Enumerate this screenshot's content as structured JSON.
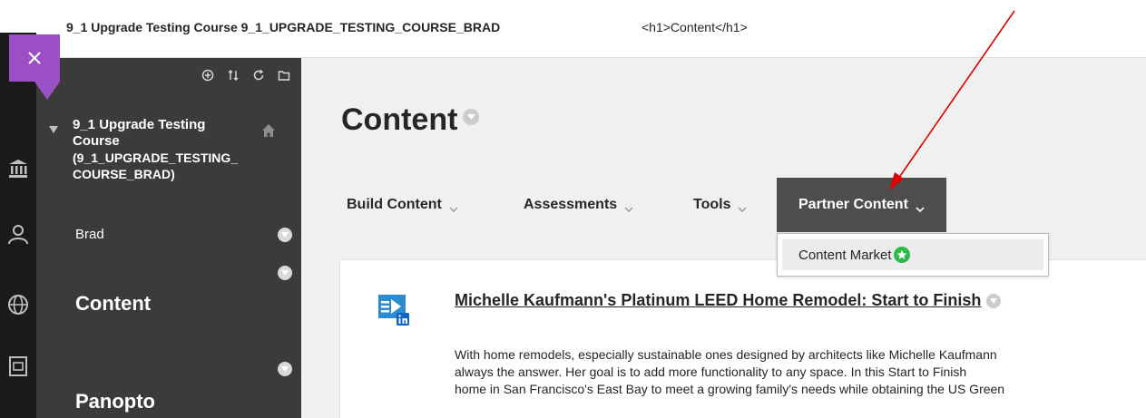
{
  "topbar": {
    "course_path": "9_1 Upgrade Testing Course 9_1_UPGRADE_TESTING_COURSE_BRAD",
    "page_crumb": "<h1>Content</h1>"
  },
  "course_menu": {
    "course_name_line1": "9_1 Upgrade Testing",
    "course_name_line2": "Course",
    "course_code_line1": "(9_1_UPGRADE_TESTING_",
    "course_code_line2": "COURSE_BRAD)",
    "items": [
      {
        "label": "Brad"
      },
      {
        "label": "Content"
      },
      {
        "label": "Panopto"
      }
    ]
  },
  "main": {
    "page_title": "Content",
    "actions": [
      {
        "label": "Build Content"
      },
      {
        "label": "Assessments"
      },
      {
        "label": "Tools"
      },
      {
        "label": "Partner Content"
      }
    ],
    "dropdown": {
      "item_label": "Content Market"
    },
    "content_item": {
      "title": "Michelle Kaufmann's Platinum LEED Home Remodel: Start to Finish",
      "desc_line1": "With home remodels, especially sustainable ones designed by architects like Michelle Kaufmann",
      "desc_line2": "always the answer. Her goal is to add more functionality to any space. In this Start to Finish",
      "desc_line3": "home in San Francisco's East Bay to meet a growing family's needs while obtaining the US Green"
    }
  },
  "colors": {
    "accent_purple": "#9b4fc4",
    "menu_bg": "#3b3b3b",
    "active_tab_bg": "#4d4d4d",
    "badge_green": "#2eb84a",
    "annotation_red": "#e00000"
  }
}
